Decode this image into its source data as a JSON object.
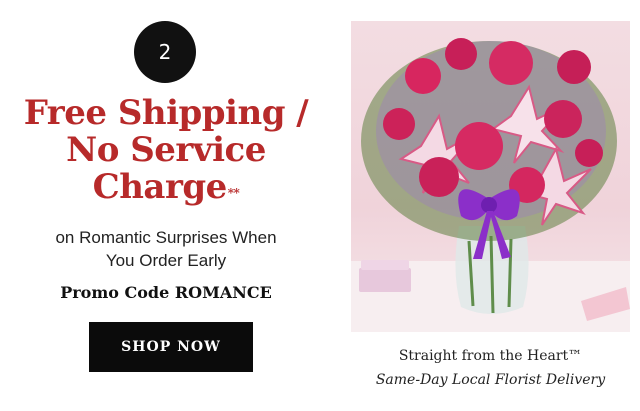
{
  "promo_step": {
    "number": "2",
    "headline_lines": [
      "Free Shipping /",
      "No Service",
      "Charge"
    ],
    "headline_footnote_mark": "**",
    "subtext_lines": [
      "on Romantic Surprises When",
      "You Order Early"
    ],
    "promo_code_text": "Promo Code ROMANCE",
    "cta_label": "SHOP NOW"
  },
  "product": {
    "image_description_icon": "flower-bouquet-image",
    "title": "Straight from the Heart™",
    "subtitle": "Same-Day Local Florist Delivery"
  },
  "colors": {
    "headline": "#b72a2a",
    "button_bg": "#0b0b0b",
    "badge_bg": "#111111",
    "photo_bg": "#f0d3da"
  }
}
